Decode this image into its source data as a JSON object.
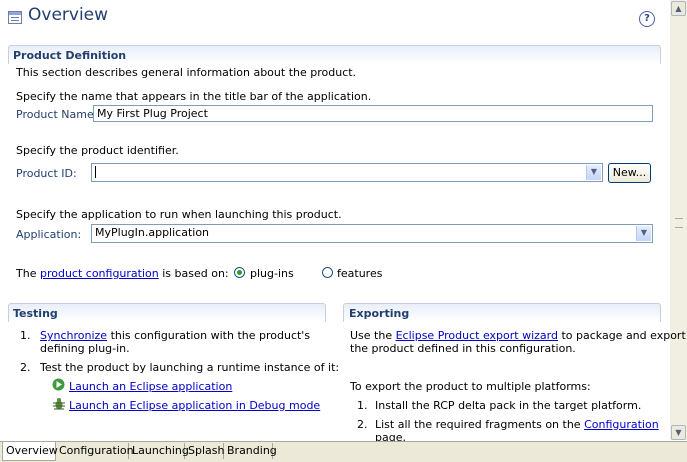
{
  "header": {
    "title": "Overview",
    "help_glyph": "?"
  },
  "product_definition": {
    "title": "Product Definition",
    "description": "This section describes general information about the product.",
    "name_hint": "Specify the name that appears in the title bar of the application.",
    "name_label": "Product Name:",
    "name_value": "My First Plug Project",
    "id_hint": "Specify the product identifier.",
    "id_label": "Product ID:",
    "id_value": "",
    "new_button": "New...",
    "app_hint": "Specify the application to run when launching this product.",
    "app_label": "Application:",
    "app_value": "MyPlugIn.application",
    "config_prefix": "The",
    "config_link": "product configuration",
    "config_suffix": "is based on:",
    "radio_plugins": "plug-ins",
    "radio_features": "features",
    "selected": "plug-ins"
  },
  "testing": {
    "title": "Testing",
    "item1_num": "1.",
    "item1_link": "Synchronize",
    "item1_text": "this configuration with the product's",
    "item1_text2": "defining plug-in.",
    "item2_num": "2.",
    "item2_text": "Test the product by launching a runtime instance of it:",
    "launch_link": "Launch an Eclipse application",
    "debug_link": "Launch an Eclipse application in Debug mode"
  },
  "exporting": {
    "title": "Exporting",
    "line1_prefix": "Use the",
    "line1_link": "Eclipse Product export wizard",
    "line1_suffix": "to package and export",
    "line2": "the product defined in this configuration.",
    "multi": "To export the product to multiple platforms:",
    "item1_num": "1.",
    "item1": "Install the RCP delta pack in the target platform.",
    "item2_num": "2.",
    "item2_prefix": "List all the required fragments on the",
    "item2_link": "Configuration",
    "item2_suffix": "page."
  },
  "tabs": [
    "Overview",
    "Configuration",
    "Launching",
    "Splash",
    "Branding"
  ],
  "active_tab": "Overview",
  "colors": {
    "title": "#233f6e",
    "link": "#0000cc",
    "tab_bar": "#ece9d8"
  }
}
